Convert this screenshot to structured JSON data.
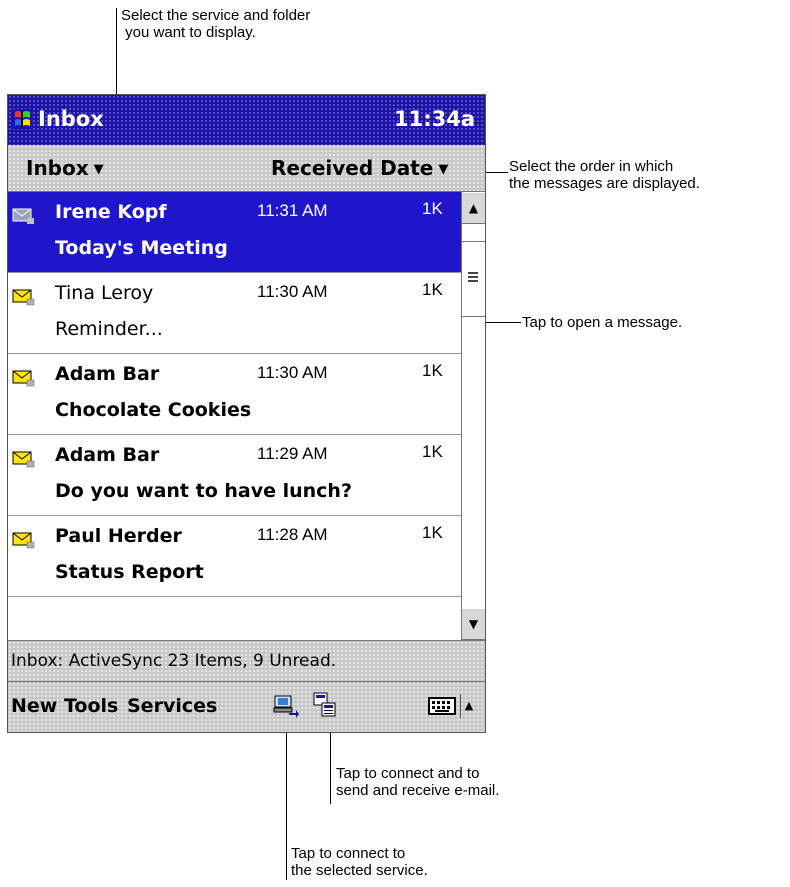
{
  "callouts": {
    "select_service": "Select the service and folder\n you want to display.",
    "select_order": "Select the order in which\nthe messages are displayed.",
    "tap_open": "Tap to open a message.",
    "tap_send_receive": "Tap to connect and to\nsend and receive e-mail.",
    "tap_connect": "Tap to connect to\nthe selected service."
  },
  "titlebar": {
    "title": "Inbox",
    "time": "11:34a"
  },
  "sortbar": {
    "folder": "Inbox",
    "order": "Received Date"
  },
  "messages": [
    {
      "sender": "Irene Kopf",
      "time": "11:31 AM",
      "size": "1K",
      "subject": "Today's Meeting",
      "unread": true,
      "selected": true
    },
    {
      "sender": "Tina Leroy",
      "time": "11:30 AM",
      "size": "1K",
      "subject": "Reminder...",
      "unread": false,
      "selected": false
    },
    {
      "sender": "Adam Bar",
      "time": "11:30 AM",
      "size": "1K",
      "subject": "Chocolate Cookies",
      "unread": true,
      "selected": false
    },
    {
      "sender": "Adam Bar",
      "time": "11:29 AM",
      "size": "1K",
      "subject": "Do you want to have lunch?",
      "unread": true,
      "selected": false
    },
    {
      "sender": "Paul Herder",
      "time": "11:28 AM",
      "size": "1K",
      "subject": "Status Report",
      "unread": true,
      "selected": false
    }
  ],
  "status": {
    "text": "Inbox: ActiveSync  23 Items, 9 Unread."
  },
  "commandbar": {
    "new_label": "New",
    "tools_label": "Tools",
    "services_label": "Services"
  },
  "icons": {
    "window": "windows-flag-icon",
    "envelope": "envelope-icon",
    "connect": "connect-icon",
    "send_receive": "send-receive-icon",
    "keyboard": "keyboard-icon"
  },
  "colors": {
    "titlebar": "#1c12a8",
    "selection": "#1f16cc",
    "bar": "#c8c8c8",
    "envelope": "#ffe600"
  }
}
